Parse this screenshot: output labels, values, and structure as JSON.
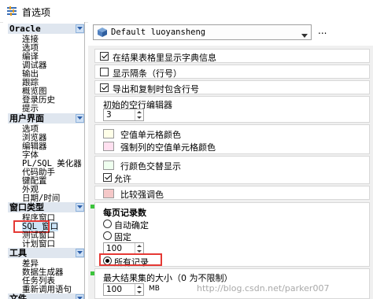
{
  "window": {
    "title": "首选项"
  },
  "sidebar": {
    "sections": [
      {
        "label": "Oracle",
        "items": [
          "连接",
          "选项",
          "编译",
          "调试器",
          "输出",
          "跟踪",
          "概览图",
          "登录历史",
          "提示"
        ]
      },
      {
        "label": "用户界面",
        "items": [
          "选项",
          "浏览器",
          "编辑器",
          "字体",
          "PL/SQL 美化器",
          "代码助手",
          "键配置",
          "外观",
          "日期/时间"
        ]
      },
      {
        "label": "窗口类型",
        "items": [
          "程序窗口",
          "SQL 窗口",
          "测试窗口",
          "计划窗口"
        ]
      },
      {
        "label": "工具",
        "items": [
          "差异",
          "数据生成器",
          "任务列表",
          "重新调用语句"
        ]
      },
      {
        "label": "文件",
        "items": []
      }
    ],
    "selected": "SQL 窗口"
  },
  "profile": {
    "value": "Default luoyansheng",
    "more": "..."
  },
  "options": {
    "show_dict_info": {
      "label": "在结果表格里显示字典信息",
      "checked": true
    },
    "show_gutter": {
      "label": "显示隔条（行号）",
      "checked": false
    },
    "export_row_numbers": {
      "label": "导出和复制时包含行号",
      "checked": true
    },
    "initial_empty_editors": {
      "label": "初始的空行编辑器",
      "value": "3"
    },
    "empty_cell_color": {
      "label": "空值单元格颜色",
      "color": "#ffffe8"
    },
    "mandatory_empty_color": {
      "label": "强制列的空值单元格颜色",
      "color": "#ffe0f0"
    },
    "row_color_alternate": {
      "label": "行颜色交替显示",
      "checked": false,
      "color": "#efffef"
    },
    "allow": {
      "label": "允许",
      "checked": true
    },
    "compare_color": {
      "label": "比较强调色",
      "color": "#f5c8c8"
    },
    "records_per_page": {
      "label": "每页记录数",
      "auto": "自动确定",
      "fixed": "固定",
      "fixed_value": "100",
      "all": "所有记录",
      "selected": "all"
    },
    "max_result_cache": {
      "label": "最大结果集的大小（0 为不限制）",
      "value": "100",
      "unit": "MB"
    }
  },
  "watermark": "http://blog.csdn.net/parker007"
}
